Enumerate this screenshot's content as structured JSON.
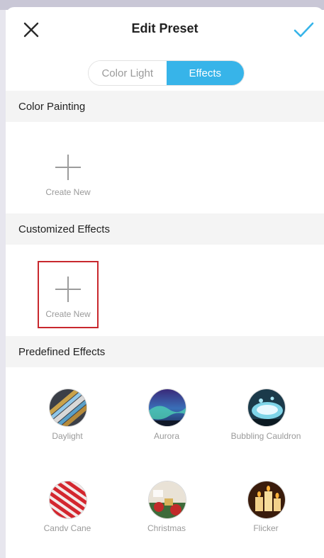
{
  "header": {
    "title": "Edit Preset",
    "close_icon": "close-icon",
    "confirm_icon": "checkmark-icon",
    "accent_color": "#37b4e9"
  },
  "segmented": {
    "options": [
      "Color Light",
      "Effects"
    ],
    "selected": "Effects"
  },
  "sections": {
    "color_painting": {
      "title": "Color Painting",
      "create_label": "Create New"
    },
    "customized_effects": {
      "title": "Customized Effects",
      "create_label": "Create New",
      "highlight_color": "#c8282e"
    },
    "predefined_effects": {
      "title": "Predefined Effects",
      "items": [
        {
          "label": "Daylight"
        },
        {
          "label": "Aurora"
        },
        {
          "label": "Bubbling Cauldron"
        },
        {
          "label": "Candv Cane"
        },
        {
          "label": "Christmas"
        },
        {
          "label": "Flicker"
        }
      ]
    }
  }
}
